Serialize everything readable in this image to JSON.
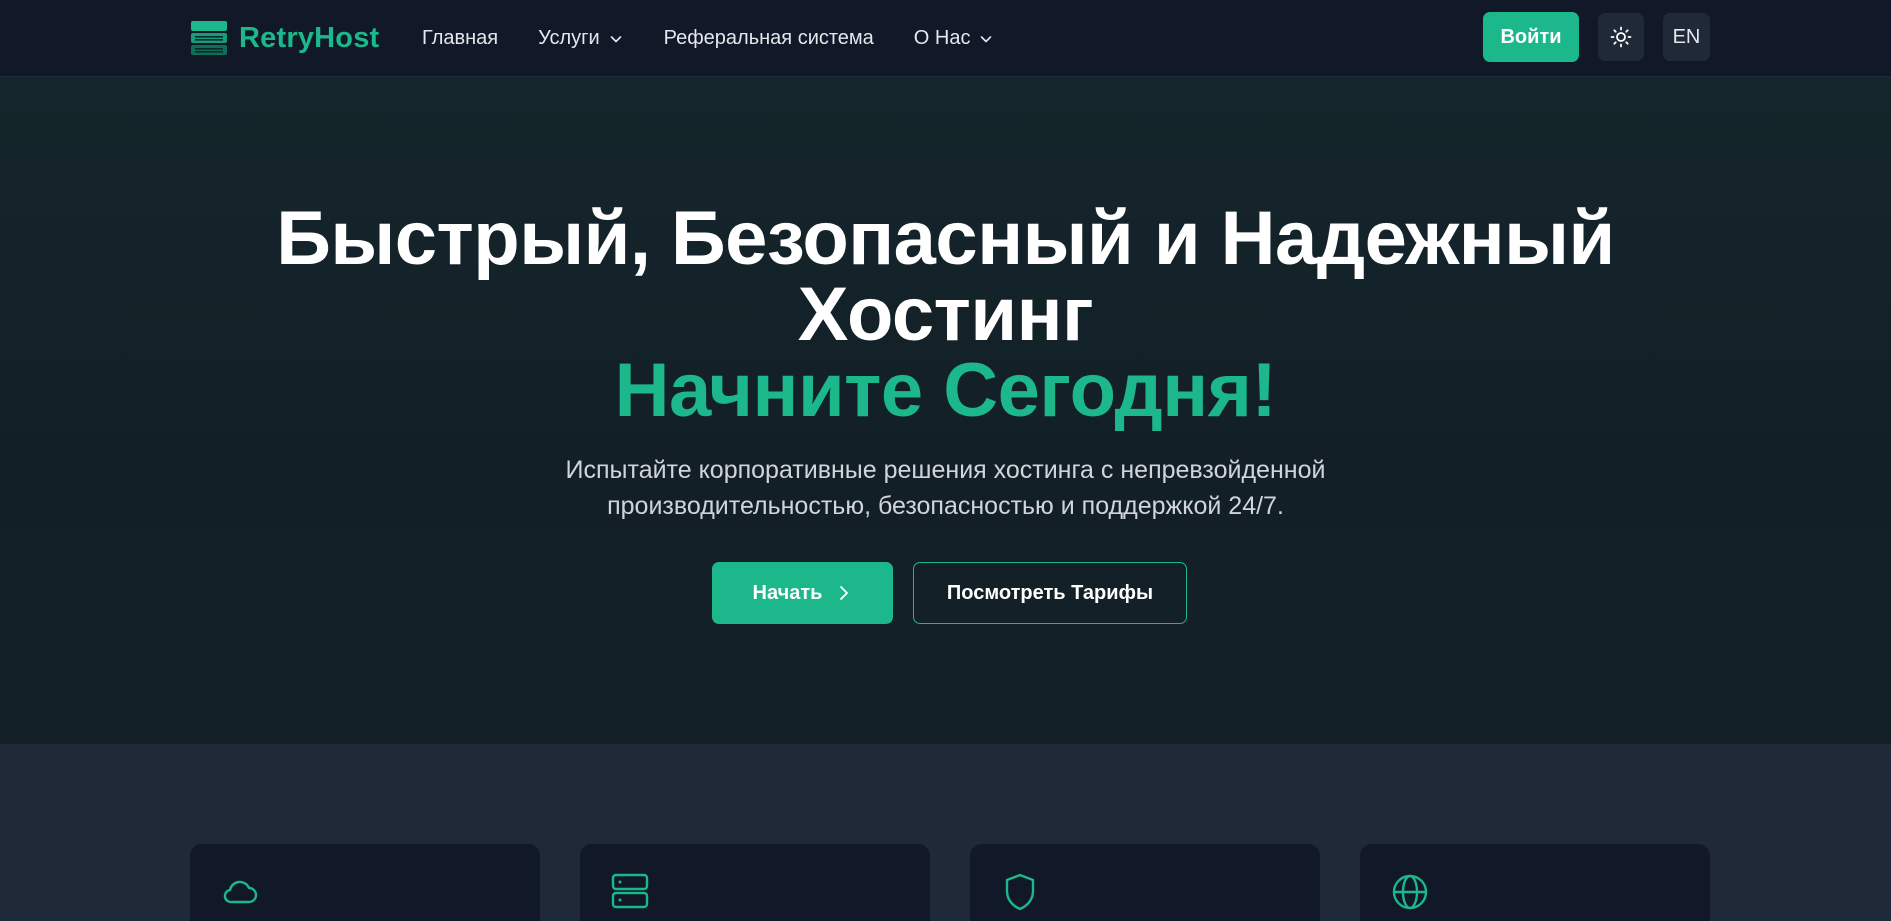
{
  "brand": {
    "name": "RetryHost",
    "accent_color": "#1db78c"
  },
  "nav": {
    "items": [
      {
        "label": "Главная",
        "has_dropdown": false
      },
      {
        "label": "Услуги",
        "has_dropdown": true
      },
      {
        "label": "Реферальная система",
        "has_dropdown": false
      },
      {
        "label": "О Нас",
        "has_dropdown": true
      }
    ],
    "login_label": "Войти",
    "theme_icon": "sun-icon",
    "language_label": "EN"
  },
  "hero": {
    "title_line1": "Быстрый, Безопасный и Надежный",
    "title_line2": "Хостинг",
    "title_accent": "Начните Сегодня!",
    "subtitle_line1": "Испытайте корпоративные решения хостинга с непревзойденной",
    "subtitle_line2": "производительностью, безопасностью и поддержкой 24/7.",
    "primary_button": "Начать",
    "secondary_button": "Посмотреть Тарифы"
  },
  "features": {
    "cards": [
      {
        "icon": "cloud-icon"
      },
      {
        "icon": "server-icon"
      },
      {
        "icon": "shield-icon"
      },
      {
        "icon": "globe-icon"
      }
    ]
  }
}
